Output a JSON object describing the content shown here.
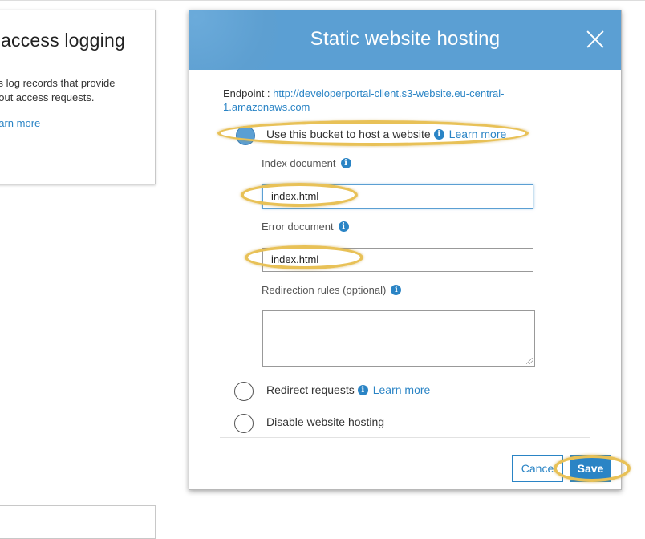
{
  "background_panel": {
    "title": "access logging",
    "description_line1": "ss log records that provide",
    "description_line2": "bout access requests.",
    "learn_more": "earn more"
  },
  "modal": {
    "title": "Static website hosting",
    "close_icon": "close-icon",
    "endpoint_label": "Endpoint : ",
    "endpoint_url": "http://developerportal-client.s3-website.eu-central-1.amazonaws.com",
    "options": [
      {
        "label": "Use this bucket to host a website",
        "learn_more": "Learn more",
        "selected": true
      },
      {
        "label": "Redirect requests",
        "learn_more": "Learn more",
        "selected": false
      },
      {
        "label": "Disable website hosting",
        "selected": false
      }
    ],
    "index_document": {
      "label": "Index document",
      "value": "index.html"
    },
    "error_document": {
      "label": "Error document",
      "value": "index.html"
    },
    "redirection_rules": {
      "label": "Redirection rules (optional)",
      "value": ""
    },
    "cancel_label": "Cance",
    "save_label": "Save"
  },
  "colors": {
    "header_blue": "#5b9fd3",
    "link_blue": "#2a84c5",
    "highlight": "#e8c157"
  }
}
